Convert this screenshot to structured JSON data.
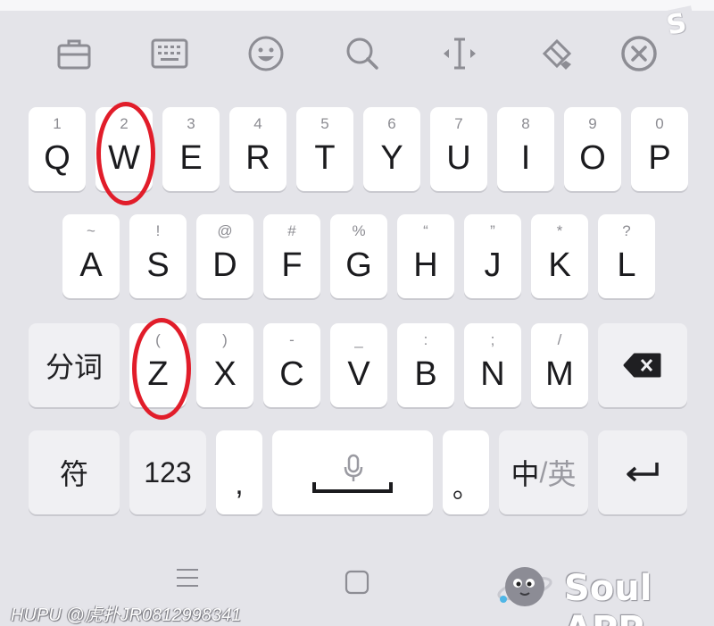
{
  "toolbar": {
    "icons": [
      "briefcase-icon",
      "keyboard-icon",
      "emoji-icon",
      "search-icon",
      "cursor-move-icon",
      "clipboard-brush-icon",
      "close-circle-icon"
    ],
    "corner_badge": "S"
  },
  "keyboard": {
    "row1": [
      {
        "hint": "1",
        "key": "Q"
      },
      {
        "hint": "2",
        "key": "W"
      },
      {
        "hint": "3",
        "key": "E"
      },
      {
        "hint": "4",
        "key": "R"
      },
      {
        "hint": "5",
        "key": "T"
      },
      {
        "hint": "6",
        "key": "Y"
      },
      {
        "hint": "7",
        "key": "U"
      },
      {
        "hint": "8",
        "key": "I"
      },
      {
        "hint": "9",
        "key": "O"
      },
      {
        "hint": "0",
        "key": "P"
      }
    ],
    "row2": [
      {
        "hint": "~",
        "key": "A"
      },
      {
        "hint": "!",
        "key": "S"
      },
      {
        "hint": "@",
        "key": "D"
      },
      {
        "hint": "#",
        "key": "F"
      },
      {
        "hint": "%",
        "key": "G"
      },
      {
        "hint": "“",
        "key": "H"
      },
      {
        "hint": "”",
        "key": "J"
      },
      {
        "hint": "*",
        "key": "K"
      },
      {
        "hint": "?",
        "key": "L"
      }
    ],
    "row3": {
      "segment_label": "分词",
      "keys": [
        {
          "hint": "(",
          "key": "Z"
        },
        {
          "hint": ")",
          "key": "X"
        },
        {
          "hint": "-",
          "key": "C"
        },
        {
          "hint": "_",
          "key": "V"
        },
        {
          "hint": ":",
          "key": "B"
        },
        {
          "hint": ";",
          "key": "N"
        },
        {
          "hint": "/",
          "key": "M"
        }
      ],
      "backspace_icon": "backspace-icon"
    },
    "row4": {
      "symbol_label": "符",
      "number_label": "123",
      "comma": ",",
      "space_icon": "microphone-icon",
      "period": "。",
      "lang_cn": "中",
      "lang_sep": "/",
      "lang_en": "英",
      "enter_icon": "enter-icon"
    },
    "highlight_color": "#e11d2a"
  },
  "navbar": {
    "icons": [
      "menu-icon",
      "home-square-icon"
    ]
  },
  "watermark": "HUPU @虎扑JR0812998341",
  "brand": {
    "name": "Soul APP",
    "logo_icon": "soul-planet-icon"
  }
}
